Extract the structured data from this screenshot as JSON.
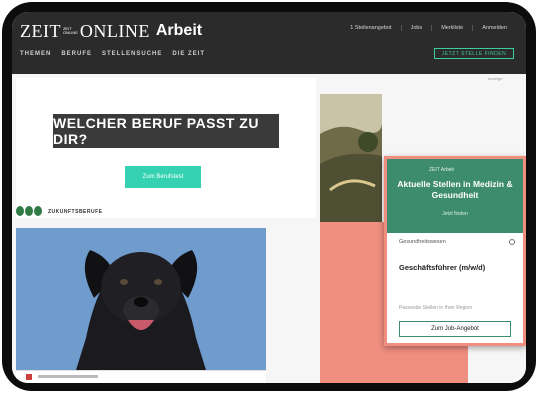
{
  "header": {
    "logo": {
      "zeit": "ZEIT",
      "mini_top": "ZEIT",
      "mini_bottom": "ONLINE",
      "online": "ONLINE",
      "arbeit": "Arbeit"
    },
    "util_nav": [
      "1 Stellenangebot",
      "Jobs",
      "Merkliste",
      "Anmelden"
    ],
    "main_nav": [
      "THEMEN",
      "BERUFE",
      "STELLENSUCHE",
      "DIE ZEIT"
    ],
    "cta_label": "JETZT STELLE FINDEN"
  },
  "promo": {
    "banner": "WELCHER BERUF PASST ZU DIR?",
    "button": "Zum Berufstest",
    "partner_name": "ZUKUNFTSBERUFE"
  },
  "corner_label": "Anzeige",
  "widget": {
    "logo_text": "ZEIT Arbeit",
    "title": "Aktuelle Stellen in Medizin & Gesundheit",
    "subtitle": "Jetzt finden",
    "filter_label": "Gesundheitswesen",
    "job_title": "Geschäftsführer (m/w/d)",
    "hint": "Passende Stellen in Ihrer Region",
    "submit": "Zum Job-Angebot"
  },
  "colors": {
    "header_bg": "#2b2b2b",
    "accent_green": "#3e8c6e",
    "teal_button": "#34d2b3",
    "coral": "#f08e80",
    "dog_bg": "#6f9ccd"
  }
}
